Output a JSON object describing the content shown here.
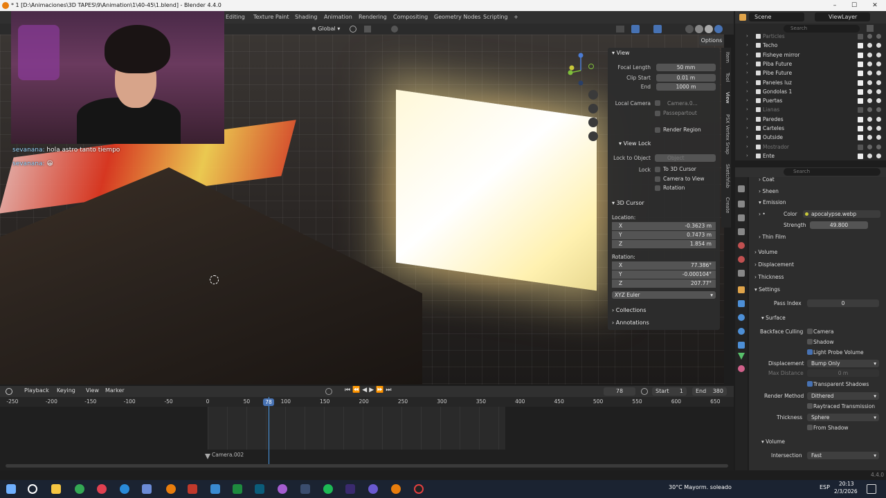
{
  "window": {
    "title": "* 1 [D:\\Animaciones\\3D TAPES\\9\\Animation\\1\\40-45\\1.blend] - Blender 4.4.0"
  },
  "workspaces": [
    "Editing",
    "Texture Paint",
    "Shading",
    "Animation",
    "Rendering",
    "Compositing",
    "Geometry Nodes",
    "Scripting",
    "+"
  ],
  "header": {
    "transform_orientation": "Global",
    "scene": "Scene",
    "view_layer": "ViewLayer",
    "options": "Options"
  },
  "chat": [
    {
      "user": "sevanana:",
      "message": "hola astro tanto tiempo"
    },
    {
      "user": "sevanana:",
      "message": "😀"
    }
  ],
  "npanel": {
    "tabs": [
      "Item",
      "Tool",
      "View",
      "PSX Vertex Snap",
      "Sketchfab",
      "Create"
    ],
    "view": {
      "title": "View",
      "focal_length_label": "Focal Length",
      "focal_length": "50 mm",
      "clip_start_label": "Clip Start",
      "clip_start": "0.01 m",
      "end_label": "End",
      "end": "1000 m",
      "local_camera_label": "Local Camera",
      "local_camera": "Camera.0...",
      "passepartout": "Passepartout",
      "render_region": "Render Region"
    },
    "view_lock": {
      "title": "View Lock",
      "lock_to_object_label": "Lock to Object",
      "lock_to_object_placeholder": "Object",
      "lock_label": "Lock",
      "to_3d_cursor": "To 3D Cursor",
      "camera_to_view": "Camera to View",
      "rotation": "Rotation"
    },
    "cursor": {
      "title": "3D Cursor",
      "location_label": "Location:",
      "x_label": "X",
      "x": "-0.3623 m",
      "y_label": "Y",
      "y": "0.7473 m",
      "z_label": "Z",
      "z": "1.854 m",
      "rotation_label": "Rotation:",
      "rx": "77.386°",
      "ry": "-0.000104°",
      "rz": "207.77°",
      "mode": "XYZ Euler"
    },
    "collections": "Collections",
    "annotations": "Annotations"
  },
  "outliner": {
    "search_placeholder": "Search",
    "rows": [
      {
        "name": "Particles",
        "dim": true
      },
      {
        "name": "Techo",
        "dim": false
      },
      {
        "name": "Fisheye mirror",
        "dim": false
      },
      {
        "name": "Piba Future",
        "dim": false
      },
      {
        "name": "Pibe Future",
        "dim": false
      },
      {
        "name": "Paneles luz",
        "dim": false
      },
      {
        "name": "Gondolas 1",
        "dim": false
      },
      {
        "name": "Puertas",
        "dim": false
      },
      {
        "name": "Lianas",
        "dim": true
      },
      {
        "name": "Paredes",
        "dim": false
      },
      {
        "name": "Carteles",
        "dim": false
      },
      {
        "name": "Outside",
        "dim": false
      },
      {
        "name": "Mostrador",
        "dim": true
      },
      {
        "name": "Ente",
        "dim": false
      }
    ]
  },
  "properties": {
    "search_placeholder": "Search",
    "coat": "Coat",
    "sheen": "Sheen",
    "emission": "Emission",
    "color_label": "Color",
    "color_value": "apocalypse.webp",
    "strength_label": "Strength",
    "strength_value": "49.800",
    "thin_film": "Thin Film",
    "volume": "Volume",
    "displacement": "Displacement",
    "thickness": "Thickness",
    "settings": "Settings",
    "pass_index_label": "Pass Index",
    "pass_index": "0",
    "surface": "Surface",
    "backface_culling_label": "Backface Culling",
    "camera": "Camera",
    "shadow": "Shadow",
    "light_probe_volume": "Light Probe Volume",
    "displacement_label": "Displacement",
    "displacement_value": "Bump Only",
    "max_distance_label": "Max Distance",
    "max_distance": "0 m",
    "transparent_shadows": "Transparent Shadows",
    "render_method_label": "Render Method",
    "render_method": "Dithered",
    "raytraced_transmission": "Raytraced Transmission",
    "thickness_label": "Thickness",
    "thickness_value": "Sphere",
    "from_shadow": "From Shadow",
    "volume2": "Volume",
    "intersection_label": "Intersection",
    "intersection_value": "Fast",
    "version": "4.4.0"
  },
  "timeline": {
    "menus": [
      "Playback",
      "Keying",
      "View",
      "Marker"
    ],
    "current_frame": "78",
    "start_label": "Start",
    "start": "1",
    "end_label": "End",
    "end": "380",
    "ticks": [
      "-250",
      "-200",
      "-150",
      "-100",
      "-50",
      "0",
      "50",
      "100",
      "150",
      "200",
      "250",
      "300",
      "350",
      "400",
      "450",
      "500",
      "550",
      "600",
      "650"
    ],
    "marker": "Camera.002"
  },
  "taskbar": {
    "weather": "30°C  Mayorm. soleado",
    "lang": "ESP",
    "time": "20:13",
    "date": "2/3/2026"
  },
  "colors": {
    "accent": "#4772b3",
    "panel": "#2d2d2d",
    "blender_orange": "#e87d0d"
  }
}
